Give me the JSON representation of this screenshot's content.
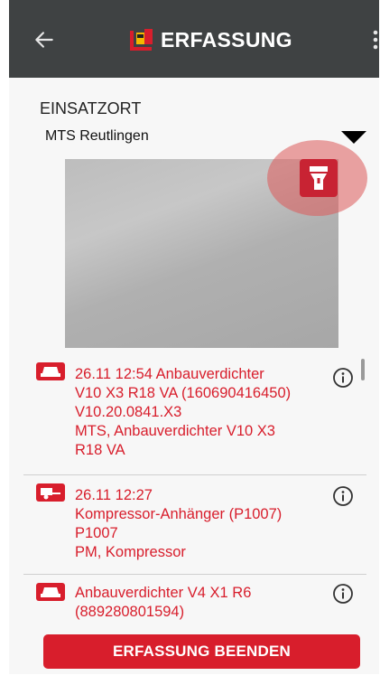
{
  "header": {
    "title": "ERFASSUNG",
    "back_icon": "arrow-left-icon",
    "logo_icon": "app-logo-icon",
    "menu_icon": "more-vertical-icon"
  },
  "location": {
    "label": "EINSATZORT",
    "selected": "MTS Reutlingen"
  },
  "flash": {
    "icon": "flashlight-icon"
  },
  "items": [
    {
      "icon": "compactor-icon",
      "lines": [
        "26.11 12:54  Anbauverdichter",
        "V10 X3 R18 VA (160690416450)",
        "V10.20.0841.X3",
        "MTS,  Anbauverdichter V10 X3",
        "R18 VA"
      ]
    },
    {
      "icon": "trailer-icon",
      "lines": [
        "26.11 12:27",
        "Kompressor-Anhänger (P1007)",
        "P1007",
        "PM,  Kompressor"
      ]
    },
    {
      "icon": "compactor-icon",
      "lines": [
        "Anbauverdichter V4 X1 R6",
        "(889280801594)"
      ]
    }
  ],
  "footer": {
    "finish_label": "ERFASSUNG BEENDEN"
  },
  "colors": {
    "accent_red": "#d81e2c",
    "header_bg": "#3f4243",
    "flash_halo": "#e07a7a"
  }
}
